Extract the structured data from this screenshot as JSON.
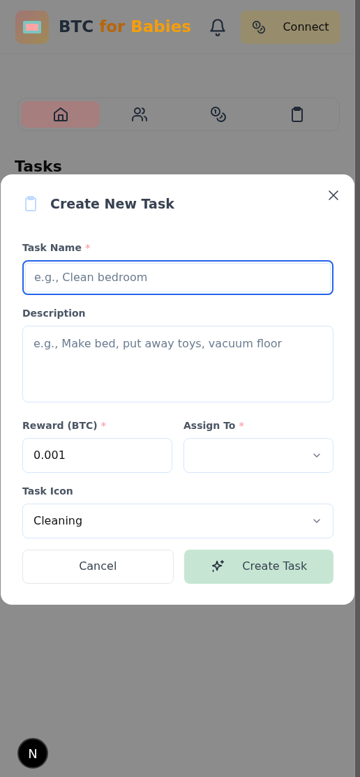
{
  "header": {
    "brand": [
      {
        "text": "BTC",
        "color": "#1f2937"
      },
      {
        "text": "for",
        "color": "#b8650a"
      },
      {
        "text": "Babies",
        "color": "#f59e0b"
      }
    ],
    "connect_button": "Connect"
  },
  "nav_tabs": [
    {
      "kind": "home",
      "selected": true
    },
    {
      "kind": "people",
      "selected": false
    },
    {
      "kind": "coins",
      "selected": false
    },
    {
      "kind": "clipboard",
      "selected": false
    }
  ],
  "page_title": "Tasks",
  "modal": {
    "title": "Create New Task",
    "fields": [
      {
        "kind": "text",
        "label": "Task Name",
        "required_mark": "*",
        "placeholder": "e.g., Clean bedroom",
        "focused": true
      },
      {
        "kind": "textarea",
        "label": "Description",
        "placeholder": "e.g., Make bed, put away toys, vacuum floor",
        "focused": false
      },
      {
        "kind": "pair",
        "fields": [
          {
            "kind": "text",
            "label": "Reward (BTC)",
            "required_mark": "*",
            "value": "0.001",
            "focused": false
          },
          {
            "kind": "select",
            "label": "Assign To",
            "required_mark": "*",
            "focused": false
          }
        ]
      },
      {
        "kind": "select",
        "label": "Task Icon",
        "value": "Cleaning",
        "focused": false
      }
    ],
    "buttons": [
      {
        "kind": "secondary",
        "label": "Cancel"
      },
      {
        "kind": "primary",
        "label": "Create Task"
      }
    ]
  },
  "dev_badge": "N"
}
